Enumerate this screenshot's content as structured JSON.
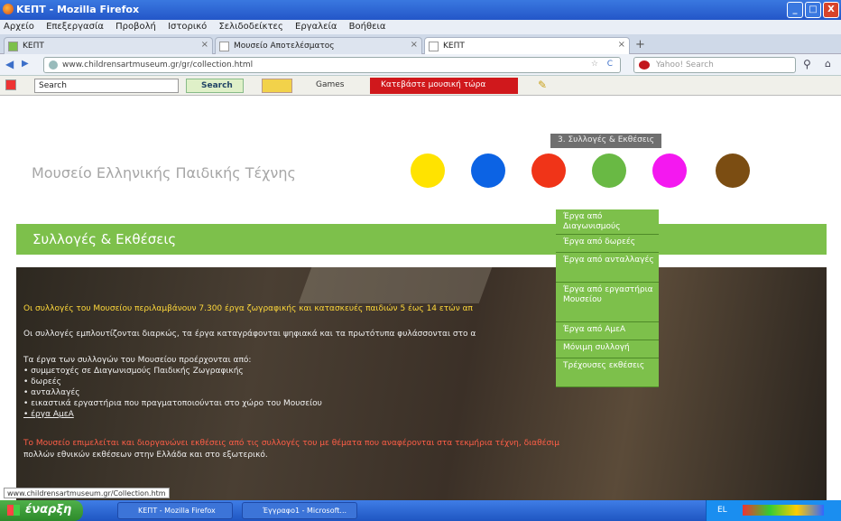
{
  "window": {
    "title": "ΚΕΠΤ - Mozilla Firefox",
    "min": "_",
    "max": "□",
    "close": "X"
  },
  "menubar": [
    "Αρχείο",
    "Επεξεργασία",
    "Προβολή",
    "Ιστορικό",
    "Σελιδοδείκτες",
    "Εργαλεία",
    "Βοήθεια"
  ],
  "tabs": [
    "ΚΕΠΤ",
    "Μουσείο Αποτελέσματος",
    "ΚΕΠΤ"
  ],
  "tab_close": "×",
  "new_tab": "+",
  "nav": {
    "back": "◀",
    "forward": "▶",
    "reload": "C",
    "star": "☆",
    "url": "www.childrensartmuseum.gr/gr/collection.html",
    "search_placeholder": "Yahoo! Search",
    "search_icon": "⚲"
  },
  "toolbar2": {
    "search_value": "Search",
    "search_button": "Search",
    "games": "Games",
    "red_button": "Κατεβάστε μουσική τώρα"
  },
  "page": {
    "site_title": "Μουσείο Ελληνικής Παιδικής Τέχνης",
    "tooltip": "3. Συλλογές & Εκθέσεις",
    "dots": [
      {
        "color": "#ffe300"
      },
      {
        "color": "#0c63e4"
      },
      {
        "color": "#f03418"
      },
      {
        "color": "#69b944"
      },
      {
        "color": "#f418f0"
      },
      {
        "color": "#7b4d12"
      }
    ],
    "section_title": "Συλλογές & Εκθέσεις",
    "body": {
      "p1": "Οι συλλογές του Μουσείου περιλαμβάνουν 7.300 έργα ζωγραφικής και κατασκευές παιδιών 5 έως 14 ετών απ",
      "p2": "Οι συλλογές εμπλουτίζονται διαρκώς, τα έργα καταγράφονται ψηφιακά και τα πρωτότυπα φυλάσσονται στο α",
      "p3_intro": "Τα έργα των συλλογών του Μουσείου προέρχονται από:",
      "list": [
        "• συμμετοχές σε Διαγωνισμούς Παιδικής Ζωγραφικής",
        "• δωρεές",
        "• ανταλλαγές",
        "• εικαστικά εργαστήρια που πραγματοποιούνται στο χώρο του Μουσείου",
        "• έργα ΑμεΑ"
      ],
      "p4": "Το Μουσείο επιμελείται και διοργανώνει εκθέσεις από τις συλλογές του με θέματα που αναφέρονται στα τεκμήρια τέχνη, διαθέσιμ",
      "p5": "πολλών εθνικών εκθέσεων στην Ελλάδα και στο εξωτερικό."
    },
    "dropdown": [
      "Έργα από Διαγωνισμούς",
      "Έργα από δωρεές",
      "Έργα από ανταλλαγές",
      "Έργα από εργαστήρια Μουσείου",
      "Έργα από ΑμεΑ",
      "Μόνιμη συλλογή",
      "Τρέχουσες εκθέσεις"
    ]
  },
  "status_url": "www.childrensartmuseum.gr/Collection.htm",
  "taskbar": {
    "start": "έναρξη",
    "tasks": [
      "ΚΕΠΤ - Mozilla Firefox",
      "Έγγραφο1 - Microsoft..."
    ],
    "tray_lang": "EL"
  }
}
